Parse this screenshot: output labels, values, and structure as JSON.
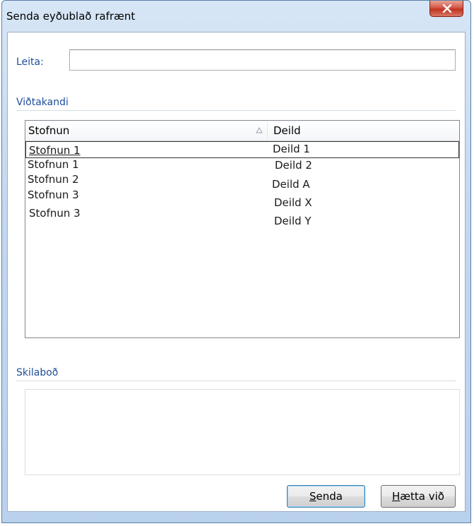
{
  "window": {
    "title": "Senda eyðublað rafrænt"
  },
  "search": {
    "label": "Leita:",
    "value": "",
    "placeholder": ""
  },
  "recipients": {
    "section_title": "Viðtakandi",
    "columns": [
      "Stofnun",
      "Deild"
    ],
    "sort_column": "Stofnun",
    "rows": [
      {
        "stofnun": "Stofnun 1",
        "deild": "Deild 1",
        "selected": true
      },
      {
        "stofnun": "Stofnun 1",
        "deild": "Deild 2",
        "selected": false
      },
      {
        "stofnun": "Stofnun 2",
        "deild": "Deild A",
        "selected": false
      },
      {
        "stofnun": "Stofnun 3",
        "deild": "Deild X",
        "selected": false
      },
      {
        "stofnun": "Stofnun 3",
        "deild": "Deild Y",
        "selected": false
      }
    ]
  },
  "message": {
    "section_title": "Skilaboð",
    "value": ""
  },
  "buttons": {
    "send_accel": "S",
    "send_rest": "enda",
    "cancel_accel": "H",
    "cancel_rest": "ætta við"
  },
  "colors": {
    "section_text": "#1f4e9b",
    "close_button": "#c0341f"
  }
}
